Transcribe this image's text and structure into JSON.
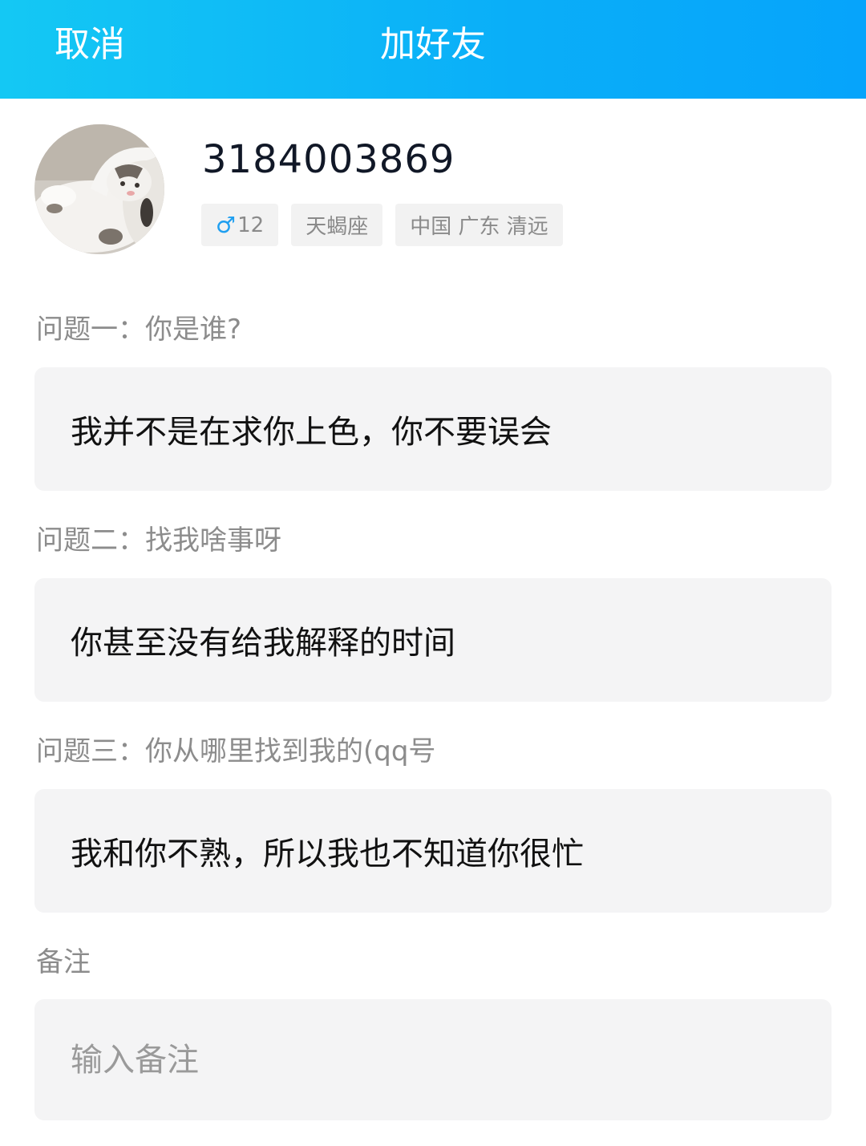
{
  "header": {
    "cancel_label": "取消",
    "title": "加好友",
    "gradient_start": "#14c8f4",
    "gradient_end": "#06a4fb"
  },
  "profile": {
    "avatar_icon": "cat-photo-avatar",
    "user_id": "3184003869",
    "tags": {
      "gender_icon": "male-icon",
      "gender_symbol": "♂",
      "age": "12",
      "constellation": "天蝎座",
      "location": "中国 广东 清远"
    }
  },
  "questions": [
    {
      "label": "问题一：你是谁?",
      "answer": "我并不是在求你上色，你不要误会"
    },
    {
      "label": "问题二：找我啥事呀",
      "answer": "你甚至没有给我解释的时间"
    },
    {
      "label": "问题三：你从哪里找到我的(qq号",
      "answer": "我和你不熟，所以我也不知道你很忙"
    }
  ],
  "remark": {
    "label": "备注",
    "value": "",
    "placeholder": "输入备注"
  }
}
